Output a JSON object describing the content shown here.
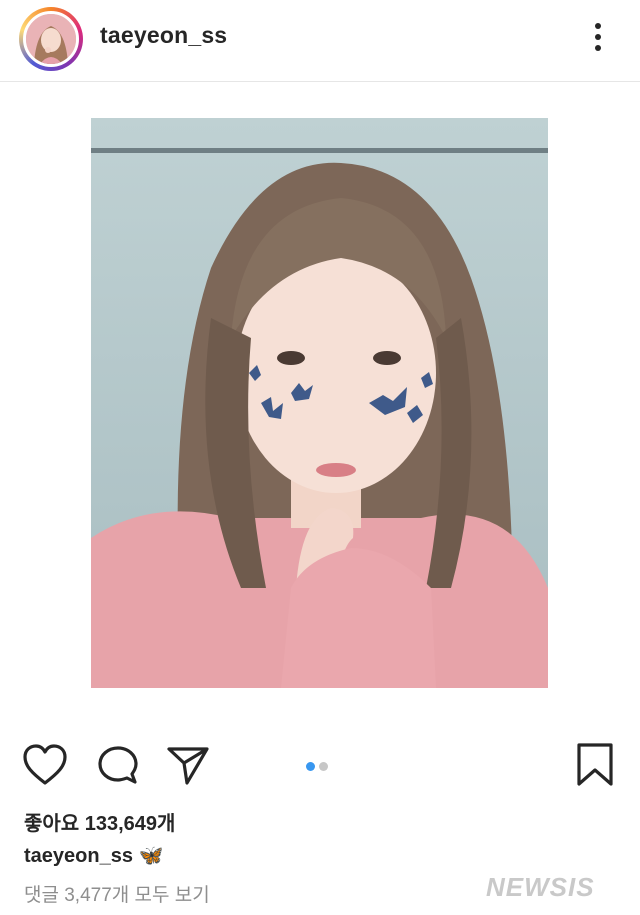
{
  "header": {
    "username": "taeyeon_ss",
    "more_icon": "more-vertical-icon"
  },
  "post": {
    "photo_description_icon": "photo",
    "carousel": {
      "current": 1,
      "total": 2,
      "active_color": "#3897f0",
      "inactive_color": "#c7c7c7"
    }
  },
  "actions": {
    "like_icon": "heart-icon",
    "comment_icon": "comment-icon",
    "share_icon": "send-icon",
    "save_icon": "bookmark-icon"
  },
  "meta": {
    "likes_label": "좋아요 133,649개",
    "caption_user": "taeyeon_ss",
    "caption_text": "🦋",
    "comments_link": "댓글 3,477개 모두 보기"
  },
  "watermark": "NEWSIS"
}
